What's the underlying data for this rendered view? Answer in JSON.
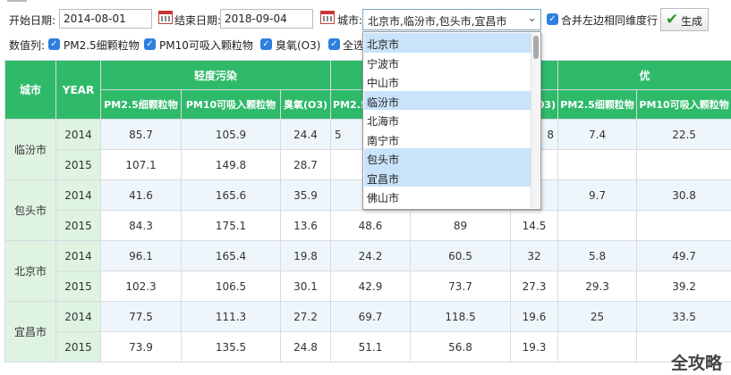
{
  "filters": {
    "start_label": "开始日期:",
    "start_value": "2014-08-01",
    "end_label": "结束日期:",
    "end_value": "2018-09-04",
    "city_label": "城市:",
    "city_value": "北京市,临汾市,包头市,宜昌市",
    "merge_label": "合并左边相同维度行",
    "generate_label": "生成"
  },
  "metrics": {
    "label": "数值列:",
    "items": [
      "PM2.5细颗粒物",
      "PM10可吸入颗粒物",
      "臭氧(O3)",
      "全选"
    ]
  },
  "city_options": [
    {
      "label": "北京市",
      "selected": true
    },
    {
      "label": "宁波市",
      "selected": false
    },
    {
      "label": "中山市",
      "selected": false
    },
    {
      "label": "临汾市",
      "selected": true
    },
    {
      "label": "北海市",
      "selected": false
    },
    {
      "label": "南宁市",
      "selected": false
    },
    {
      "label": "包头市",
      "selected": true
    },
    {
      "label": "宜昌市",
      "selected": true
    },
    {
      "label": "佛山市",
      "selected": false
    }
  ],
  "table": {
    "col_city": "城市",
    "col_year": "YEAR",
    "group1": "轻度污染",
    "group3": "优",
    "sub1": [
      "PM2.5细颗粒物",
      "PM10可吸入颗粒物",
      "臭氧(O3)",
      "PM2.5"
    ],
    "sub2_tail": "03)",
    "sub3": [
      "PM2.5细颗粒物",
      "PM10可吸入颗粒物"
    ],
    "rows": [
      {
        "city": "临汾市",
        "year": "2014",
        "v": [
          "85.7",
          "105.9",
          "24.4",
          "5",
          "",
          "8",
          "7.4",
          "22.5"
        ]
      },
      {
        "city": "",
        "year": "2015",
        "v": [
          "107.1",
          "149.8",
          "28.7",
          "",
          "",
          "",
          "",
          ""
        ]
      },
      {
        "city": "包头市",
        "year": "2014",
        "v": [
          "41.6",
          "165.6",
          "35.9",
          "",
          "",
          "",
          "9.7",
          "30.8"
        ]
      },
      {
        "city": "",
        "year": "2015",
        "v": [
          "84.3",
          "175.1",
          "13.6",
          "48.6",
          "89",
          "14.5",
          "",
          ""
        ]
      },
      {
        "city": "北京市",
        "year": "2014",
        "v": [
          "96.1",
          "165.4",
          "19.8",
          "24.2",
          "60.5",
          "32",
          "5.8",
          "49.7"
        ]
      },
      {
        "city": "",
        "year": "2015",
        "v": [
          "102.3",
          "106.5",
          "30.1",
          "42.9",
          "73.7",
          "27.3",
          "29.3",
          "39.2"
        ]
      },
      {
        "city": "宜昌市",
        "year": "2014",
        "v": [
          "77.5",
          "111.3",
          "27.2",
          "69.7",
          "118.5",
          "19.6",
          "25",
          "33.5"
        ]
      },
      {
        "city": "",
        "year": "2015",
        "v": [
          "73.9",
          "135.5",
          "24.8",
          "51.1",
          "56.8",
          "19.3",
          "",
          ""
        ]
      }
    ]
  },
  "watermark": "全攻略",
  "colors": {
    "header_green": "#2fba6a",
    "check_blue": "#2d7fe0",
    "row_blue": "#eef6fb",
    "city_cell": "#dff3e2",
    "option_selected": "#c8e3fa"
  }
}
